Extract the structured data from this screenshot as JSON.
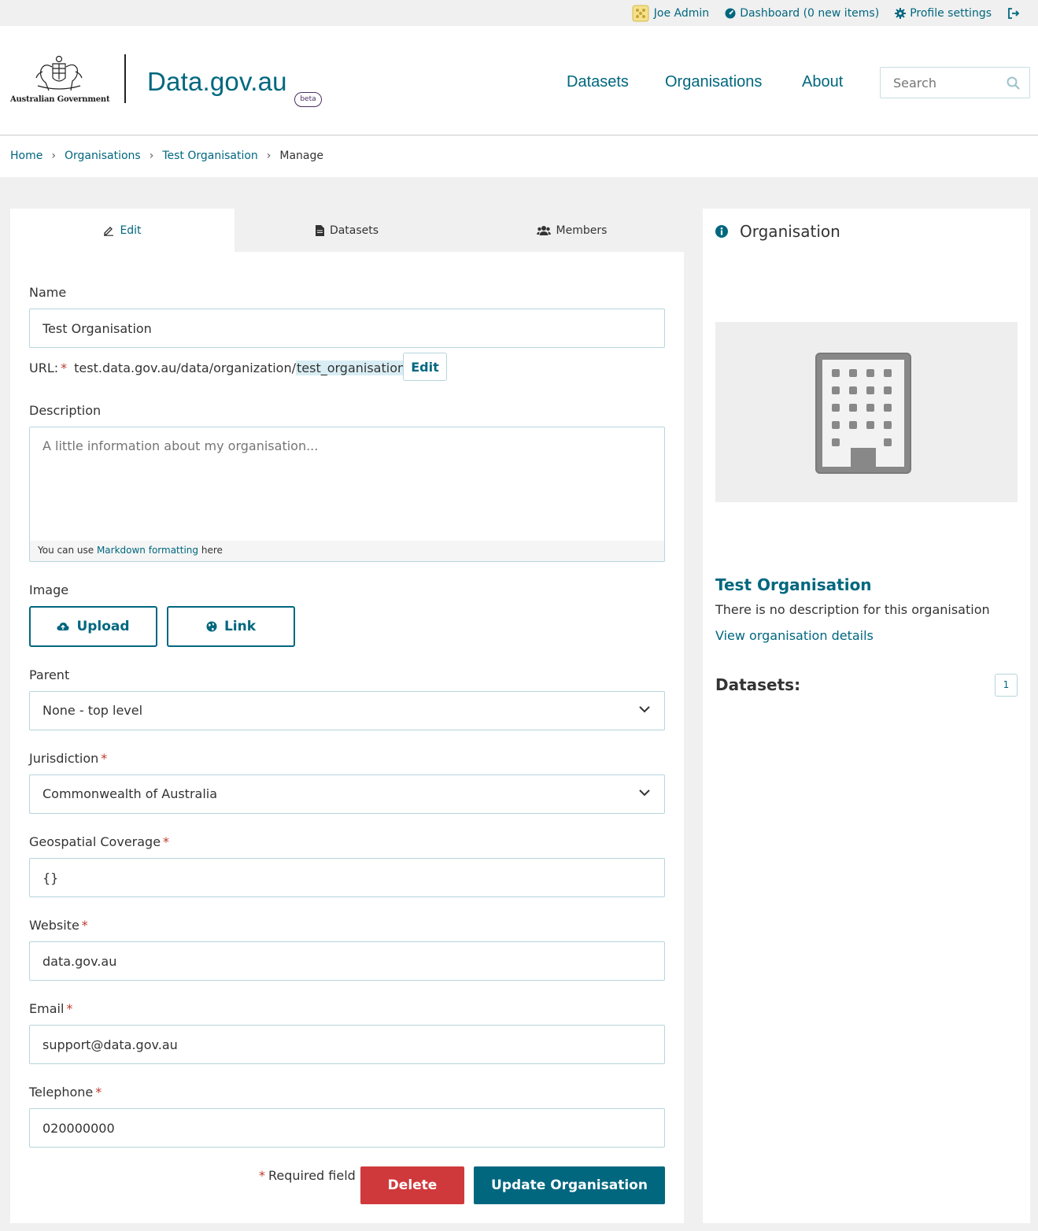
{
  "account": {
    "user_name": "Joe Admin",
    "dashboard_label": "Dashboard (0 new items)",
    "profile_label": "Profile settings"
  },
  "header": {
    "gov_name": "Australian Government",
    "site_name": "Data.gov.au",
    "beta_label": "beta",
    "nav": [
      "Datasets",
      "Organisations",
      "About"
    ],
    "search_placeholder": "Search"
  },
  "breadcrumb": [
    "Home",
    "Organisations",
    "Test Organisation",
    "Manage"
  ],
  "tabs": [
    "Edit",
    "Datasets",
    "Members"
  ],
  "form": {
    "name_label": "Name",
    "name_value": "Test Organisation",
    "url_label": "URL:",
    "url_prefix": "test.data.gov.au/data/organization/",
    "url_slug": "test_organisation",
    "url_edit_label": "Edit",
    "description_label": "Description",
    "description_placeholder": "A little information about my organisation...",
    "markdown_hint_pre": "You can use",
    "markdown_hint_link": "Markdown formatting",
    "markdown_hint_post": "here",
    "image_label": "Image",
    "upload_label": "Upload",
    "link_label": "Link",
    "parent_label": "Parent",
    "parent_value": "None - top level",
    "jurisdiction_label": "Jurisdiction",
    "jurisdiction_value": "Commonwealth of Australia",
    "geospatial_label": "Geospatial Coverage",
    "geospatial_value": "{}",
    "website_label": "Website",
    "website_value": "data.gov.au",
    "email_label": "Email",
    "email_value": "support@data.gov.au",
    "telephone_label": "Telephone",
    "telephone_value": "020000000",
    "required_marker": "*",
    "required_note": "Required field",
    "delete_label": "Delete",
    "update_label": "Update Organisation"
  },
  "side": {
    "title": "Organisation",
    "org_name": "Test Organisation",
    "org_description": "There is no description for this organisation",
    "details_link": "View organisation details",
    "datasets_label": "Datasets:",
    "datasets_count": "1"
  },
  "colors": {
    "brand": "#00677f",
    "danger": "#d0393b",
    "required": "#c0392b"
  },
  "icons": {
    "user": "crest-avatar-icon",
    "dashboard": "dashboard-icon",
    "profile": "gear-icon",
    "logout": "logout-icon",
    "search": "search-icon",
    "edit_tab": "pencil-icon",
    "datasets_tab": "file-icon",
    "members_tab": "users-icon",
    "upload": "cloud-upload-icon",
    "link": "globe-icon",
    "info": "info-circle-icon",
    "org_placeholder": "building-icon"
  }
}
